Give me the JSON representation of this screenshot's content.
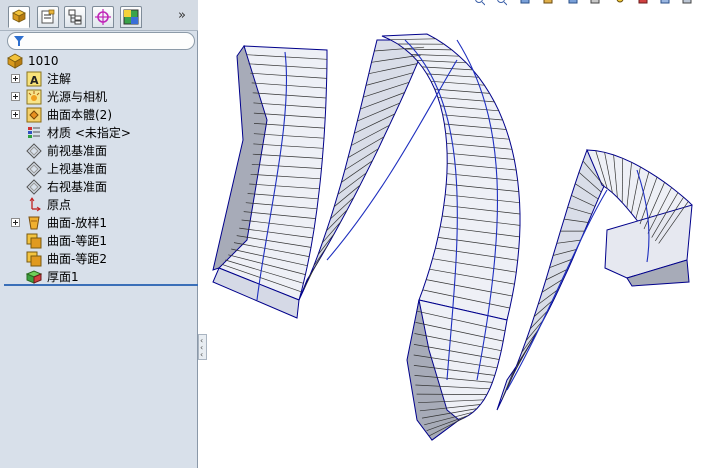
{
  "tabs": [
    {
      "name": "featuremanager"
    },
    {
      "name": "propertymanager"
    },
    {
      "name": "configurationmanager"
    },
    {
      "name": "dimxpertmanager"
    },
    {
      "name": "displaymanager"
    }
  ],
  "tab_more": "»",
  "tree": {
    "root": "1010",
    "items": [
      {
        "label": "注解",
        "expandable": true,
        "icon": "annotations-icon"
      },
      {
        "label": "光源与相机",
        "expandable": true,
        "icon": "lights-cameras-icon"
      },
      {
        "label": "曲面本體(2)",
        "expandable": true,
        "icon": "surface-bodies-icon"
      },
      {
        "label": "材质 <未指定>",
        "expandable": false,
        "icon": "material-icon"
      },
      {
        "label": "前视基准面",
        "expandable": false,
        "icon": "plane-icon"
      },
      {
        "label": "上视基准面",
        "expandable": false,
        "icon": "plane-icon"
      },
      {
        "label": "右视基准面",
        "expandable": false,
        "icon": "plane-icon"
      },
      {
        "label": "原点",
        "expandable": false,
        "icon": "origin-icon"
      },
      {
        "label": "曲面-放样1",
        "expandable": true,
        "icon": "surface-loft-icon"
      },
      {
        "label": "曲面-等距1",
        "expandable": false,
        "icon": "surface-offset-icon"
      },
      {
        "label": "曲面-等距2",
        "expandable": false,
        "icon": "surface-offset-icon"
      },
      {
        "label": "厚面1",
        "expandable": false,
        "icon": "thicken-icon"
      }
    ]
  },
  "colors": {
    "panel_bg": "#d8e0ea",
    "selection_line": "#3a6fb8",
    "edge": "#00008b",
    "curve": "#1e2fbf",
    "face_light": "#eef0f6",
    "face_dark": "#a7abb8"
  }
}
